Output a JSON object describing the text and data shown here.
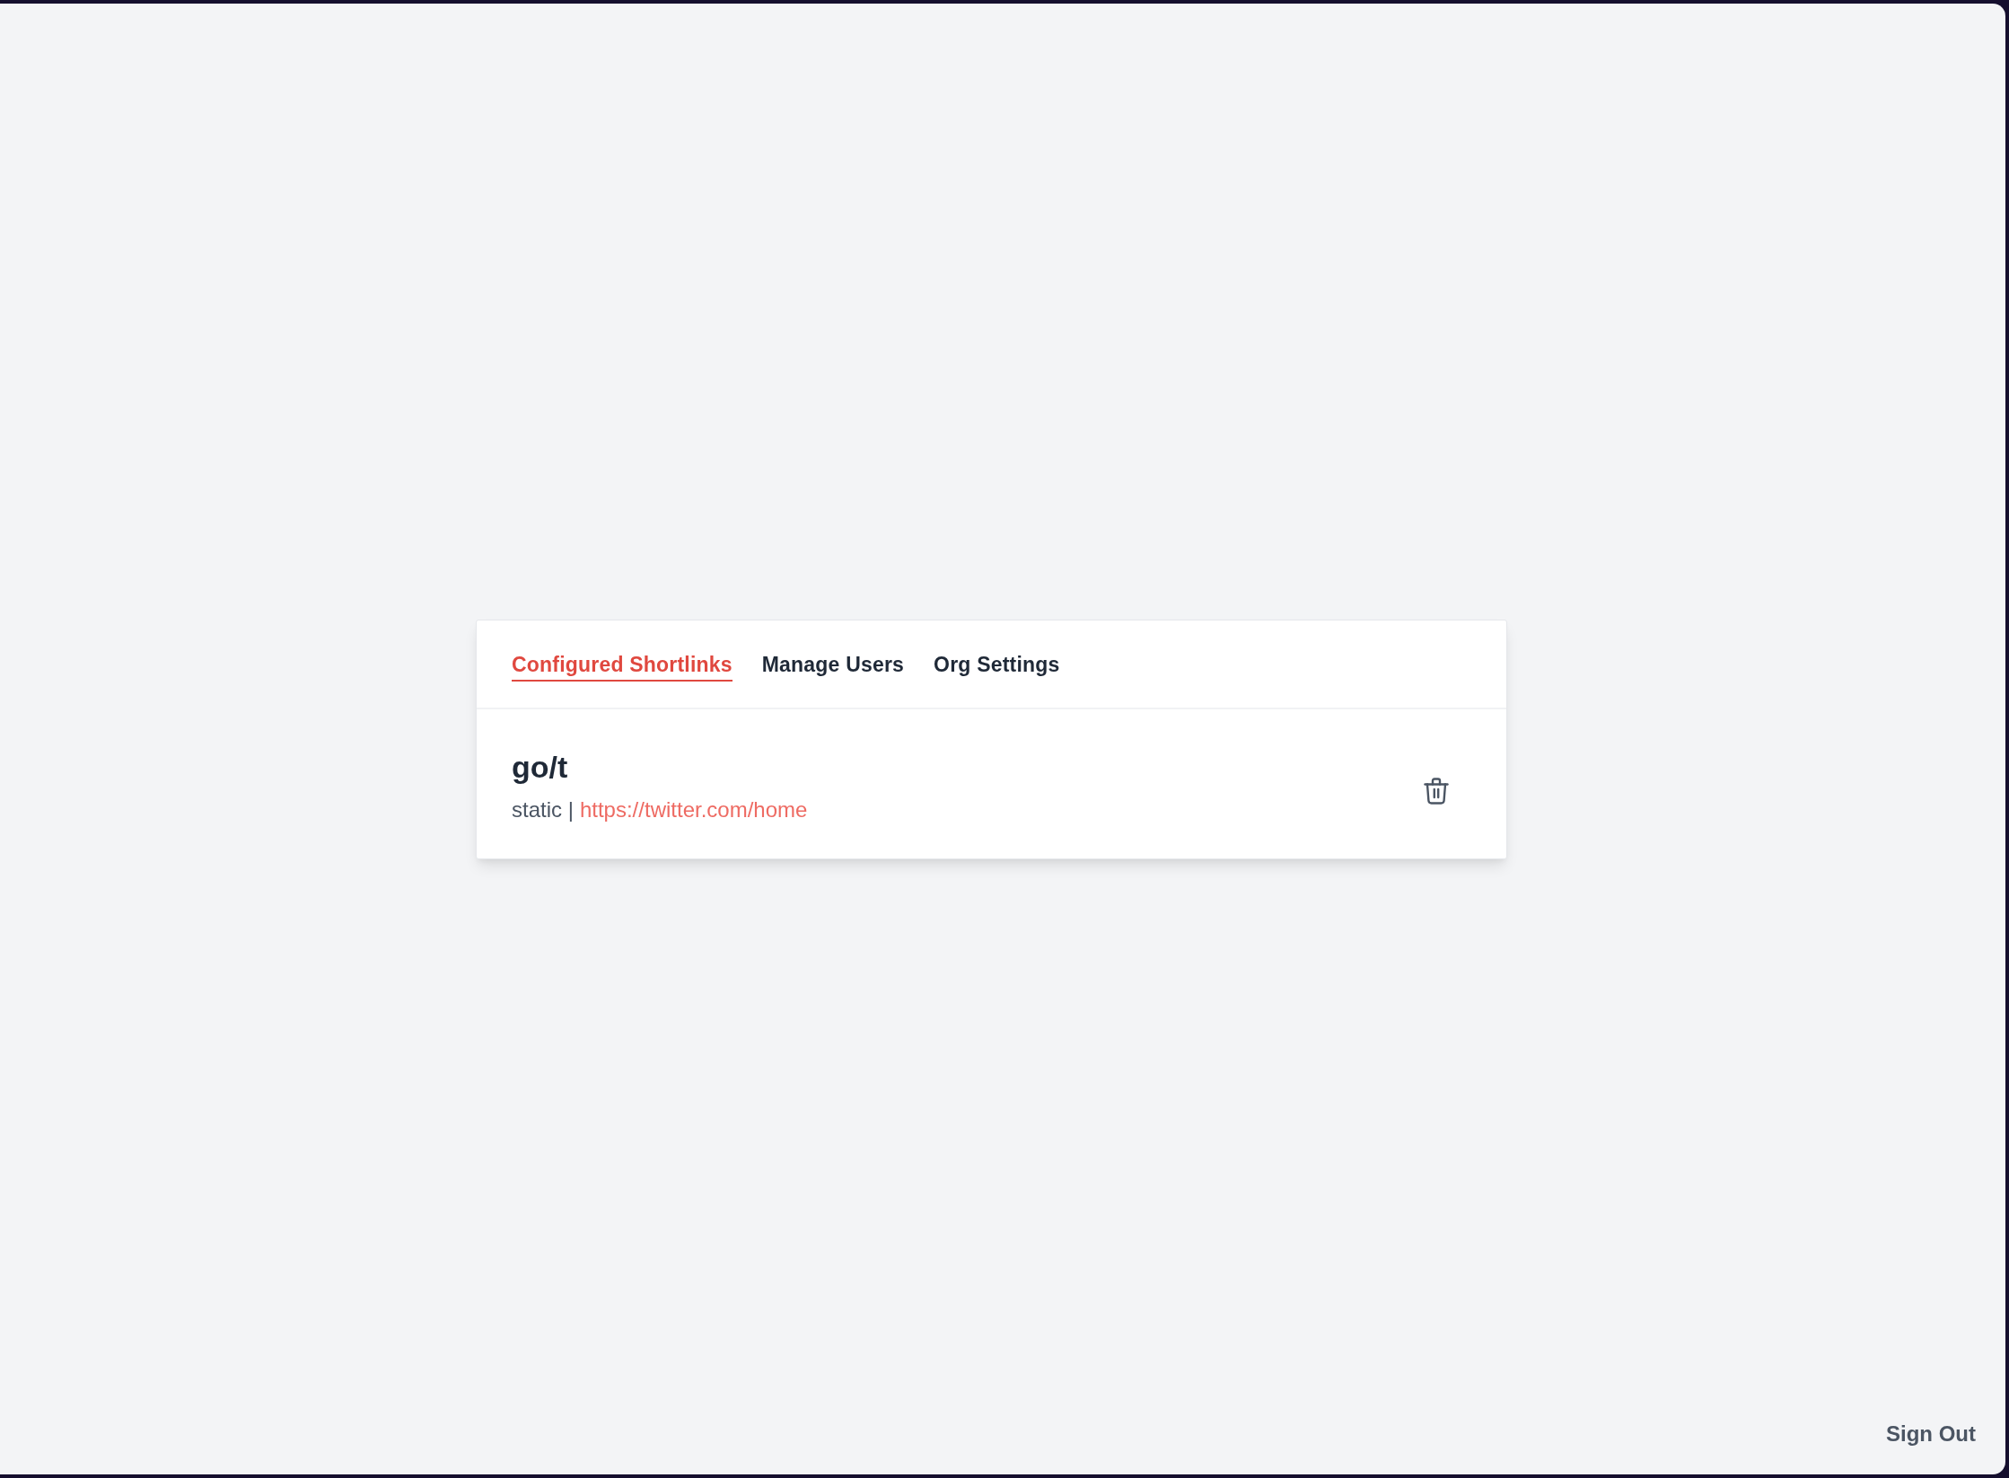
{
  "tabs": [
    {
      "label": "Configured Shortlinks",
      "selected": true
    },
    {
      "label": "Manage Users",
      "selected": false
    },
    {
      "label": "Org Settings",
      "selected": false
    }
  ],
  "shortlinks": [
    {
      "name": "go/t",
      "type": "static",
      "separator": "|",
      "url": "https://twitter.com/home"
    }
  ],
  "sign_out": {
    "label": "Sign Out"
  }
}
